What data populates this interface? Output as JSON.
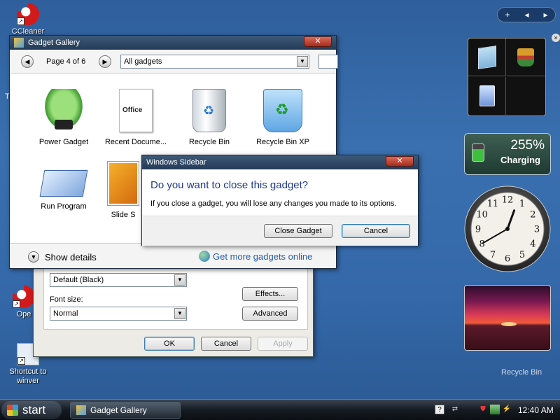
{
  "desktop": {
    "icons": [
      {
        "label": "CCleaner"
      },
      {
        "label": "Ope"
      },
      {
        "label": "Shortcut to winver"
      }
    ],
    "partial_label_t": "T"
  },
  "sidebar": {
    "controls": {
      "add": "+",
      "prev": "◂",
      "next": "▸"
    },
    "close": "×",
    "battery": {
      "percent": "255%",
      "state": "Charging"
    },
    "clock": {
      "hour": 12,
      "minute": 40
    },
    "slideshow": {
      "colors": [
        "#7a1a52",
        "#f25a3a"
      ]
    },
    "recycle_bin_label": "Recycle Bin"
  },
  "settings_window": {
    "theme_value": "Default (Black)",
    "font_size_label": "Font size:",
    "font_size_value": "Normal",
    "effects_label": "Effects...",
    "advanced_label": "Advanced",
    "ok_label": "OK",
    "cancel_label": "Cancel",
    "apply_label": "Apply"
  },
  "gallery": {
    "title": "Gadget Gallery",
    "page_label": "Page 4 of 6",
    "filter_value": "All gadgets",
    "items": [
      {
        "label": "Power Gadget",
        "icon": "power-plug-icon"
      },
      {
        "label": "Recent Docume...",
        "icon": "office-document-icon"
      },
      {
        "label": "Recycle Bin",
        "icon": "recycle-bin-icon"
      },
      {
        "label": "Recycle Bin XP",
        "icon": "recycle-bin-xp-icon"
      },
      {
        "label": "Run Program",
        "icon": "run-program-icon"
      },
      {
        "label": "Slide S",
        "icon": "slideshow-icon"
      }
    ],
    "office_logo_text": "Office",
    "show_details": "Show details",
    "more_online": "Get more gadgets online"
  },
  "dialog": {
    "title": "Windows Sidebar",
    "question": "Do you want to close this gadget?",
    "text": "If you close a gadget, you will lose any changes you made to its options.",
    "close_label": "Close Gadget",
    "cancel_label": "Cancel"
  },
  "taskbar": {
    "start_label": "start",
    "task_label": "Gadget Gallery",
    "help": "?",
    "time": "12:40 AM"
  },
  "colors": {
    "accent": "#2a5ea8",
    "dialog_title": "#1f3a8a"
  }
}
